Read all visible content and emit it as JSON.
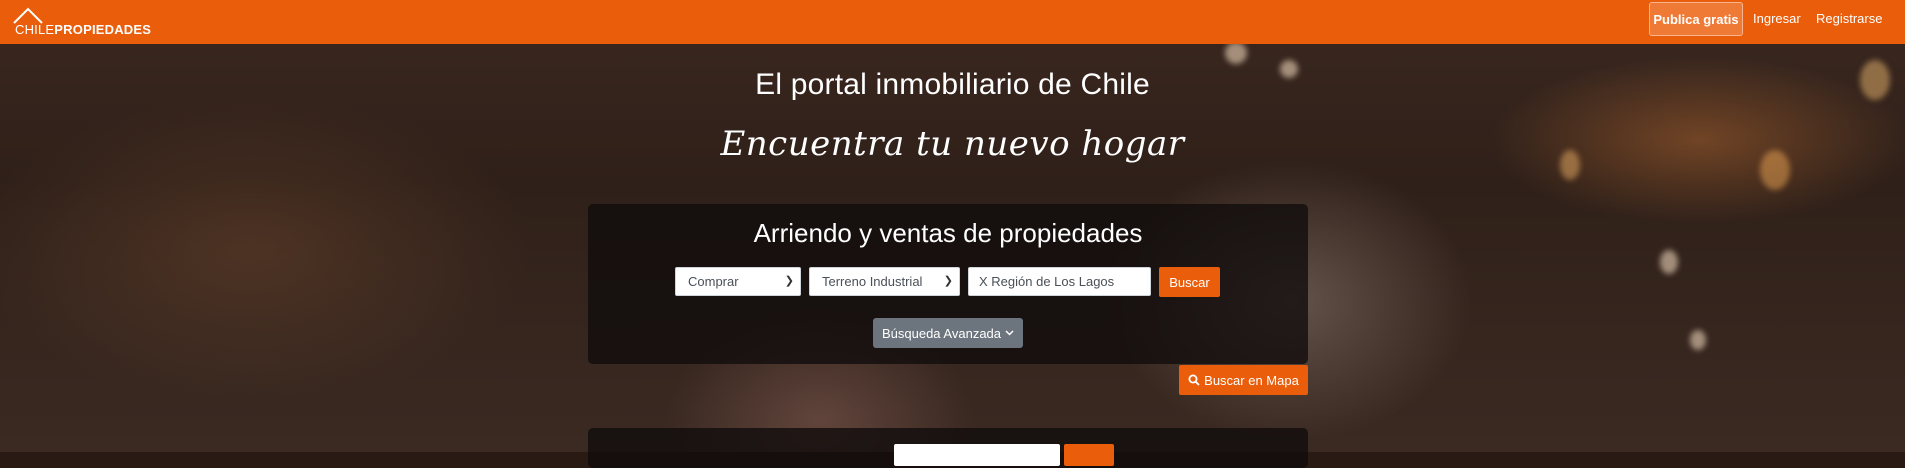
{
  "brand": {
    "logo_light": "CHILE",
    "logo_bold": "PROPIEDADES",
    "color": "#ea5d0b"
  },
  "navbar": {
    "publish_label": "Publica gratis",
    "login_label": "Ingresar",
    "register_label": "Registrarse"
  },
  "hero": {
    "title": "El portal inmobiliario de Chile",
    "tagline": "Encuentra tu nuevo hogar"
  },
  "search": {
    "title": "Arriendo y ventas de propiedades",
    "operation_selected": "Comprar",
    "property_type_selected": "Terreno Industrial",
    "region_value": "X Región de Los Lagos",
    "search_button": "Buscar",
    "advanced_button": "Búsqueda Avanzada",
    "map_button": "Buscar en Mapa"
  },
  "icons": {
    "chevron": "chevron-down-icon",
    "search": "search-icon",
    "roof": "house-roof-icon"
  }
}
